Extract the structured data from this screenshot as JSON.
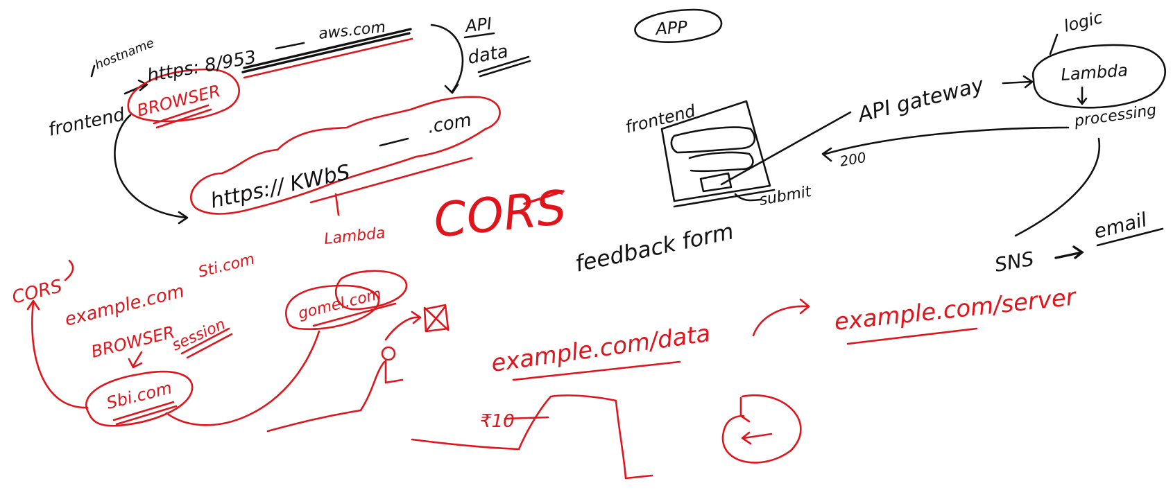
{
  "canvas": {
    "background": "#ffffff"
  },
  "colors": {
    "ink_black": "#111111",
    "ink_red": "#e0141b"
  },
  "left_top": {
    "hostname_note": "hostname",
    "frontend_label": "frontend",
    "browser_label": "BROWSER",
    "url_https": "https: 8/953",
    "aws_com": "aws.com",
    "api_label": "API",
    "data_label": "data",
    "kwbs_url": "https:// KWbS",
    "dotcom": ".com",
    "lambda_label": "Lambda",
    "cors_big": "CORS"
  },
  "left_bottom": {
    "cors_small": "CORS",
    "example_com": "example.com",
    "sti_com_top": "Sti.com",
    "browser_label": "BROWSER",
    "session_label": "session",
    "sbi_com": "Sbi.com",
    "gomel_com": "gomel.com"
  },
  "right_top": {
    "app_label": "APP",
    "logic_label": "logic",
    "lambda_label": "Lambda",
    "frontend_label": "frontend",
    "api_gateway_label": "API gateway",
    "processing_label": "processing",
    "status_200": "200",
    "submit_label": "submit",
    "feedback_form": "feedback form",
    "sns_label": "SNS",
    "email_label": "email"
  },
  "bottom_center": {
    "example_data": "example.com/data",
    "example_server": "example.com/server",
    "price_label": "₹10"
  }
}
